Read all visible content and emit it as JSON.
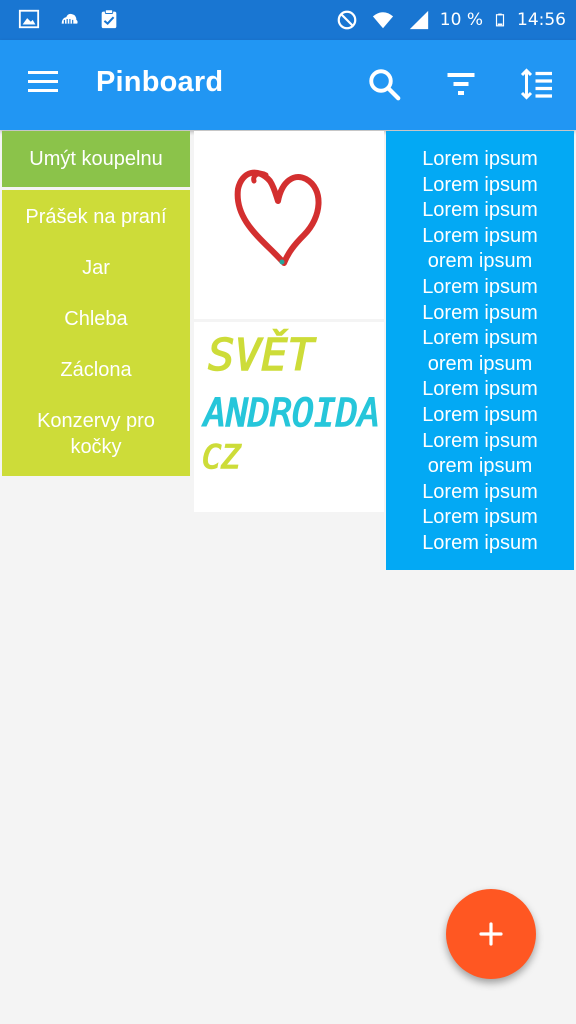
{
  "status_bar": {
    "battery_percent": "10 %",
    "time": "14:56",
    "icons": [
      "image-icon",
      "cloud-icon",
      "clipboard-check-icon",
      "do-not-disturb-icon",
      "wifi-icon",
      "signal-icon",
      "battery-icon"
    ]
  },
  "app_bar": {
    "title": "Pinboard",
    "icons": [
      "menu-icon",
      "search-icon",
      "filter-icon",
      "sort-icon"
    ]
  },
  "notes": {
    "green": {
      "text": "Umýt koupelnu",
      "color": "#8bc34a"
    },
    "lime": {
      "color": "#cddc39",
      "items": [
        "Prášek na praní",
        "Jar",
        "Chleba",
        "Záclona",
        "Konzervy pro",
        "kočky"
      ]
    },
    "blue": {
      "color": "#03a9f4",
      "lines": [
        "Lorem ipsum",
        "Lorem ipsum",
        "Lorem ipsum",
        "Lorem ipsum",
        "orem ipsum",
        "Lorem ipsum",
        "Lorem ipsum",
        "Lorem ipsum",
        "orem ipsum",
        "Lorem ipsum",
        "Lorem ipsum",
        "Lorem ipsum",
        "orem ipsum",
        "Lorem ipsum",
        "Lorem ipsum",
        "Lorem ipsum"
      ]
    }
  },
  "drawings": {
    "heart": {
      "stroke_color": "#d32f2f"
    },
    "handwriting": {
      "lines": [
        "SVĚT",
        "ANDROIDA",
        "CZ"
      ],
      "colors": [
        "#cddc39",
        "#26c6da",
        "#cddc39"
      ]
    }
  },
  "fab": {
    "icon": "plus-icon",
    "color": "#ff5722"
  }
}
